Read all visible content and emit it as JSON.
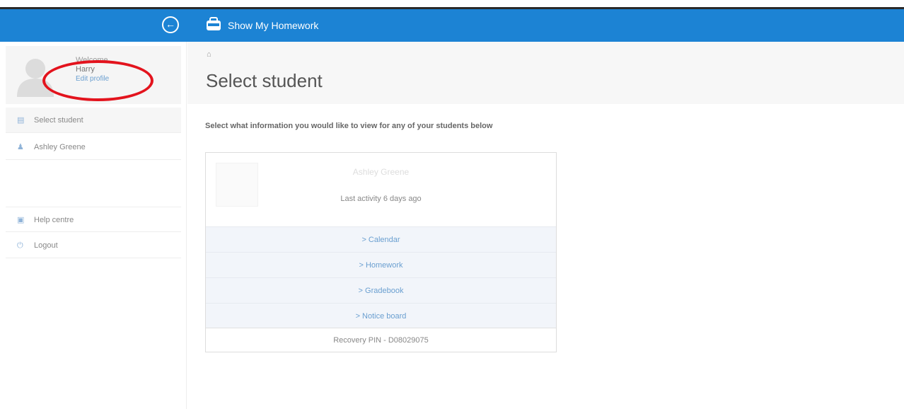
{
  "header": {
    "app_title": "Show My Homework",
    "back_icon": "back-arrow-icon",
    "logo_icon": "satchel-logo-icon",
    "color": "#1c83d4"
  },
  "sidebar": {
    "profile": {
      "welcome": "Welcome,",
      "name": "Harry",
      "edit_label": "Edit profile"
    },
    "items": [
      {
        "label": "Select student",
        "icon": "student-card-icon"
      },
      {
        "label": "Ashley Greene",
        "icon": "person-icon"
      },
      {
        "label": "Help centre",
        "icon": "help-book-icon"
      },
      {
        "label": "Logout",
        "icon": "power-icon"
      }
    ]
  },
  "main": {
    "breadcrumb": "⌂",
    "title": "Select student",
    "instruction": "Select what information you would like to view for any of your students below",
    "card": {
      "name": "Ashley Greene",
      "last_activity": "Last activity 6 days ago",
      "links": [
        "> Calendar",
        "> Homework",
        "> Gradebook",
        "> Notice board"
      ],
      "recovery": "Recovery PIN - D08029075"
    }
  },
  "annotation": {
    "color": "#e3131d"
  }
}
